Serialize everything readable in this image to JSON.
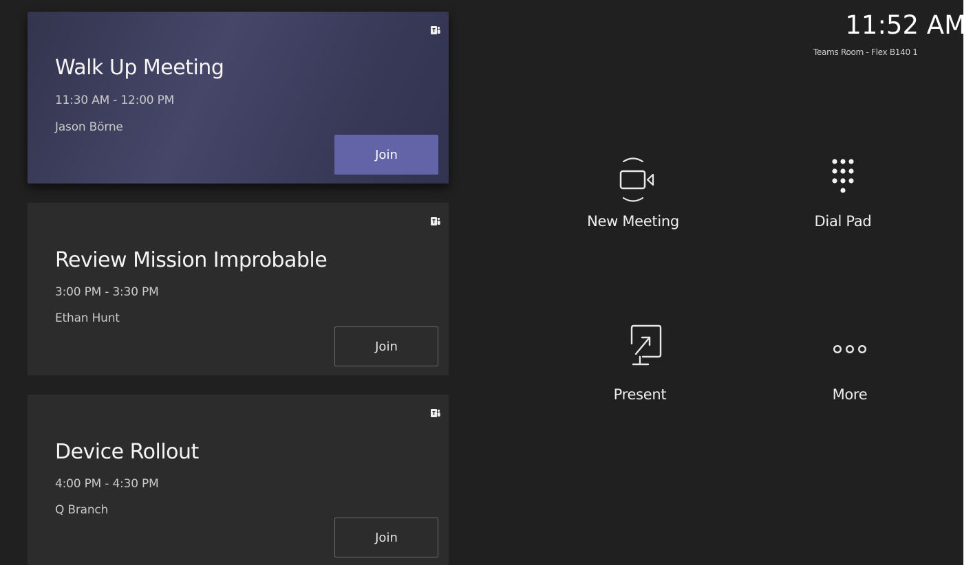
{
  "status": {
    "time": "11:52 AM",
    "room": "Teams Room - Flex B140 1"
  },
  "meetings": [
    {
      "title": "Walk Up Meeting",
      "time": "11:30 AM - 12:00 PM",
      "organizer": "Jason Börne",
      "join_label": "Join",
      "icon": "teams-icon"
    },
    {
      "title": "Review Mission Improbable",
      "time": "3:00 PM - 3:30 PM",
      "organizer": "Ethan Hunt",
      "join_label": "Join",
      "icon": "teams-icon"
    },
    {
      "title": "Device Rollout",
      "time": "4:00 PM - 4:30 PM",
      "organizer": "Q Branch",
      "join_label": "Join",
      "icon": "teams-icon"
    }
  ],
  "actions": [
    {
      "label": "New Meeting",
      "icon": "video-camera-icon"
    },
    {
      "label": "Dial Pad",
      "icon": "dial-pad-icon"
    },
    {
      "label": "Present",
      "icon": "present-screen-icon"
    },
    {
      "label": "More",
      "icon": "more-dots-icon"
    }
  ],
  "colors": {
    "background": "#202020",
    "card": "#2c2c2c",
    "active_card": "#464669",
    "join_accent": "#6264a7"
  }
}
